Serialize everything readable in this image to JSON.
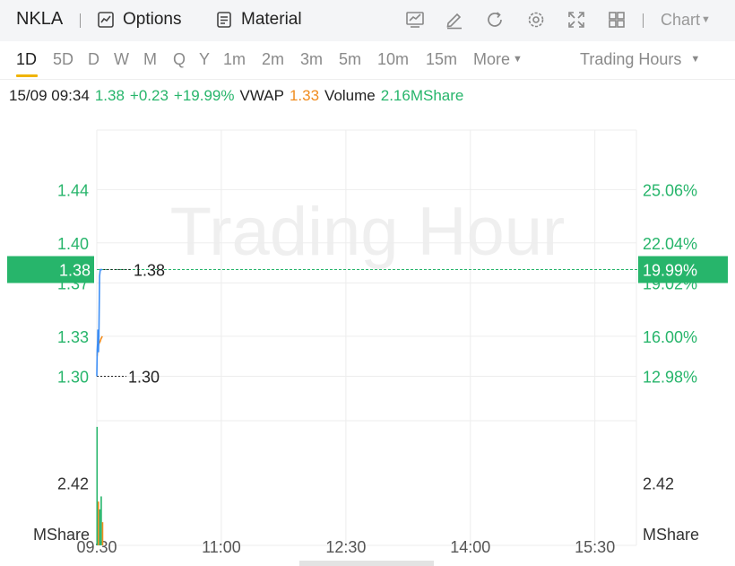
{
  "header": {
    "ticker": "NKLA",
    "options_label": "Options",
    "material_label": "Material",
    "chart_label": "Chart"
  },
  "periods": {
    "items": [
      "1D",
      "5D",
      "D",
      "W",
      "M",
      "Q",
      "Y",
      "1m",
      "2m",
      "3m",
      "5m",
      "10m",
      "15m"
    ],
    "active": "1D",
    "more_label": "More",
    "session_label": "Trading Hours"
  },
  "info": {
    "datetime": "15/09 09:34",
    "price": "1.38",
    "change": "+0.23",
    "change_pct": "+19.99%",
    "vwap_label": "VWAP",
    "vwap_value": "1.33",
    "volume_label": "Volume",
    "volume_value": "2.16MShare"
  },
  "colors": {
    "up": "#27b56b",
    "vwap": "#f08c1f",
    "price_line": "#3d8ef5",
    "grid": "#ededed",
    "watermark": "#efefef"
  },
  "chart_data": {
    "type": "line",
    "watermark": "Trading Hour",
    "x_ticks": [
      "09:30",
      "11:00",
      "12:30",
      "14:00",
      "15:30"
    ],
    "y_left_ticks": [
      "1.44",
      "1.40",
      "1.37",
      "1.33",
      "1.30"
    ],
    "y_right_ticks": [
      "25.06%",
      "22.04%",
      "19.02%",
      "16.00%",
      "12.98%"
    ],
    "ylim": [
      1.2667,
      1.4846
    ],
    "current_price_label": "1.38",
    "current_pct_label": "19.99%",
    "high_marker": "1.38",
    "low_marker": "1.30",
    "price_series": {
      "name": "Price",
      "minutes": [
        0,
        0.3,
        0.6,
        0.8,
        1.0,
        1.2,
        1.5,
        2.0,
        2.5,
        3.0,
        3.5,
        4.0
      ],
      "values": [
        1.3,
        1.32,
        1.325,
        1.335,
        1.32,
        1.318,
        1.33,
        1.375,
        1.38,
        1.38,
        1.38,
        1.38
      ]
    },
    "vwap_series": {
      "name": "VWAP",
      "minutes": [
        0.2,
        0.6,
        1.0,
        1.4,
        1.8,
        2.4,
        3.0,
        4.0
      ],
      "values": [
        1.315,
        1.32,
        1.322,
        1.324,
        1.325,
        1.326,
        1.328,
        1.33
      ]
    },
    "volume": {
      "axis_label": "2.42",
      "unit_label": "MShare",
      "unit_label_right": "MShare",
      "max": 4.84,
      "bars": [
        {
          "minute": 0,
          "value": 4.6,
          "color": "#27b56b"
        },
        {
          "minute": 1,
          "value": 1.7,
          "color": "#f08c1f"
        },
        {
          "minute": 2,
          "value": 1.4,
          "color": "#27b56b"
        },
        {
          "minute": 3,
          "value": 1.9,
          "color": "#27b56b"
        },
        {
          "minute": 4,
          "value": 0.9,
          "color": "#f08c1f"
        }
      ]
    }
  }
}
